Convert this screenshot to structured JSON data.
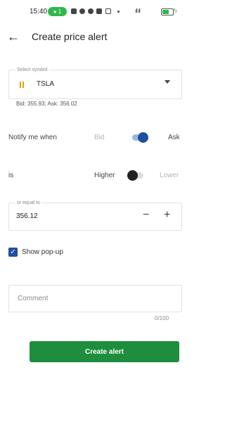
{
  "status_bar": {
    "time": "15:40",
    "badge_count": "1",
    "signal_text": "ıll ıll",
    "icons": [
      "linkedin-icon",
      "whatsapp-icon",
      "dollar-icon",
      "mail-icon",
      "instagram-icon",
      "more-dot-icon",
      "signal-icon",
      "battery-icon",
      "charging-icon"
    ]
  },
  "header": {
    "back_icon": "arrow-left-icon",
    "title": "Create price alert"
  },
  "symbol_select": {
    "label": "Select symbol",
    "value": "TSLA",
    "icon": "symbol-bars-icon",
    "icon_color": "#e0a400"
  },
  "quote": {
    "text": "Bid: 355.93; Ask: 356.02"
  },
  "notify": {
    "label": "Notify me when",
    "option_left": "Bid",
    "option_right": "Ask",
    "selected": "Ask"
  },
  "condition": {
    "label": "is",
    "option_left": "Higher",
    "option_right": "Lower",
    "selected": "Higher"
  },
  "price_input": {
    "label": "or equal to",
    "value": "356.12",
    "minus_label": "−",
    "plus_label": "+"
  },
  "popup": {
    "label": "Show pop-up",
    "checked": true,
    "check_glyph": "✓"
  },
  "comment": {
    "placeholder": "Comment",
    "counter": "0/100"
  },
  "actions": {
    "create_label": "Create alert"
  },
  "colors": {
    "accent": "#1f4fa0",
    "button": "#1e8e3e",
    "status_green": "#2fb84a"
  }
}
